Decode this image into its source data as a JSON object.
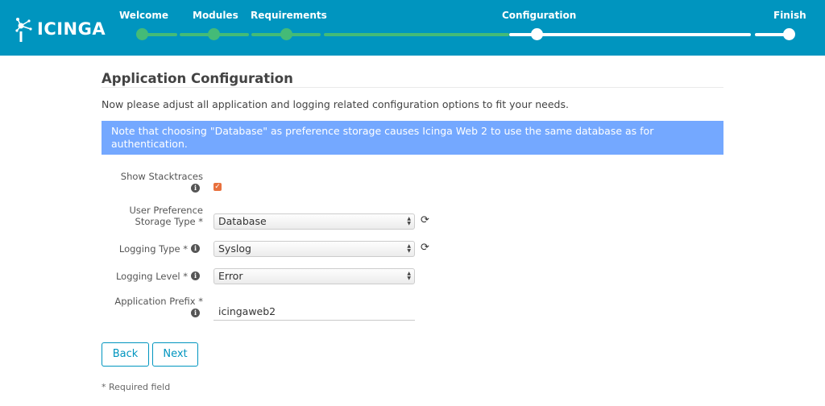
{
  "header": {
    "logo_text": "ICINGA",
    "steps": [
      {
        "label": "Welcome",
        "state": "done"
      },
      {
        "label": "Modules",
        "state": "done"
      },
      {
        "label": "Requirements",
        "state": "done"
      },
      {
        "label": "Configuration",
        "state": "current"
      },
      {
        "label": "Finish",
        "state": "todo"
      }
    ]
  },
  "page": {
    "title": "Application Configuration",
    "intro": "Now please adjust all application and logging related configuration options to fit your needs.",
    "notice": "Note that choosing \"Database\" as preference storage causes Icinga Web 2 to use the same database as for authentication."
  },
  "form": {
    "show_stacktraces": {
      "label": "Show Stacktraces",
      "checked": true
    },
    "preference_storage": {
      "label_line1": "User Preference",
      "label_line2": "Storage Type *",
      "value": "Database"
    },
    "logging_type": {
      "label": "Logging Type *",
      "value": "Syslog"
    },
    "logging_level": {
      "label": "Logging Level *",
      "value": "Error"
    },
    "application_prefix": {
      "label": "Application Prefix *",
      "value": "icingaweb2"
    }
  },
  "buttons": {
    "back": "Back",
    "next": "Next"
  },
  "footer": {
    "required_note": "* Required field"
  },
  "colors": {
    "header": "#0095bf",
    "progress_done": "#44bb77",
    "notice": "#74a8ff",
    "checkbox": "#e8703d"
  },
  "icons": {
    "info": "info-icon",
    "refresh": "refresh-icon"
  }
}
